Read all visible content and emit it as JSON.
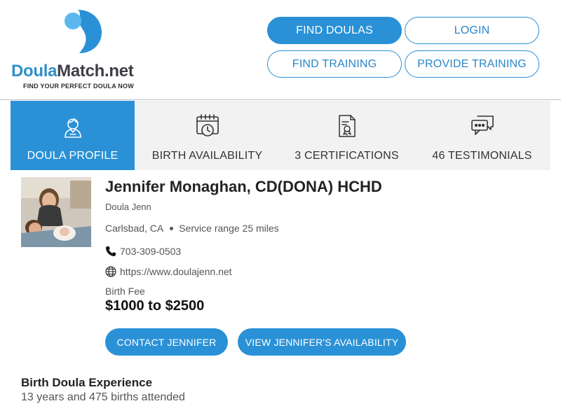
{
  "brand": {
    "name_part1": "Doula",
    "name_part2": "Match.net",
    "tagline": "FIND YOUR PERFECT DOULA NOW",
    "colors": {
      "primary": "#2a91d6",
      "light": "#5bb7ee",
      "dark": "#3c3f45"
    }
  },
  "nav": {
    "find_doulas": "FIND DOULAS",
    "login": "LOGIN",
    "find_training": "FIND TRAINING",
    "provide_training": "PROVIDE TRAINING"
  },
  "tabs": [
    {
      "label": "DOULA PROFILE",
      "icon": "doula-person-icon",
      "active": true
    },
    {
      "label": "BIRTH AVAILABILITY",
      "icon": "calendar-clock-icon",
      "active": false
    },
    {
      "label": "3 CERTIFICATIONS",
      "icon": "certificate-icon",
      "active": false
    },
    {
      "label": "46 TESTIMONIALS",
      "icon": "chat-bubbles-icon",
      "active": false
    }
  ],
  "profile": {
    "name": "Jennifer Monaghan, CD(DONA) HCHD",
    "nickname": "Doula Jenn",
    "city": "Carlsbad, CA",
    "service_range": "Service range 25 miles",
    "phone": "703-309-0503",
    "website": "https://www.doulajenn.net",
    "fee_label": "Birth Fee",
    "fee_value": "$1000 to $2500"
  },
  "actions": {
    "contact": "CONTACT JENNIFER",
    "availability": "VIEW JENNIFER'S AVAILABILITY"
  },
  "experience": {
    "title": "Birth Doula Experience",
    "text": "13 years and 475 births attended"
  }
}
